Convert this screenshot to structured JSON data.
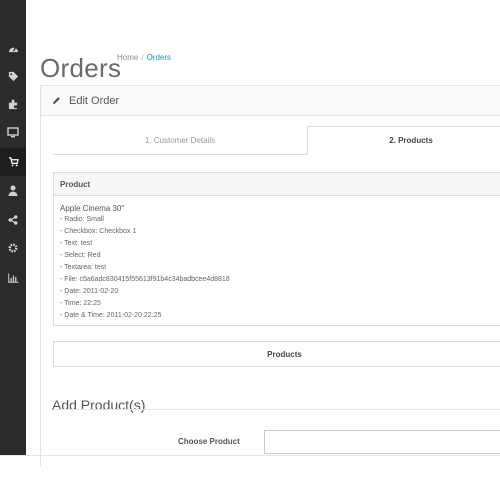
{
  "sidebar": {
    "items": [
      {
        "icon": "dashboard-icon",
        "active": false
      },
      {
        "icon": "tags-icon",
        "active": false
      },
      {
        "icon": "puzzle-icon",
        "active": false
      },
      {
        "icon": "desktop-icon",
        "active": false
      },
      {
        "icon": "shopping-cart-icon",
        "active": true
      },
      {
        "icon": "user-icon",
        "active": false
      },
      {
        "icon": "share-icon",
        "active": false
      },
      {
        "icon": "cog-icon",
        "active": false
      },
      {
        "icon": "bar-chart-icon",
        "active": false
      }
    ]
  },
  "page": {
    "title": "Orders",
    "breadcrumb": [
      "Home",
      "Orders"
    ]
  },
  "panel": {
    "title": "Edit Order",
    "icon": "pencil-icon"
  },
  "tabs": [
    {
      "label": "1. Customer Details",
      "active": false
    },
    {
      "label": "2. Products",
      "active": true
    }
  ],
  "product_table": {
    "header": "Product",
    "product_name": "Apple Cinema 30\"",
    "options": [
      "- Radio: Small",
      "- Checkbox: Checkbox 1",
      "- Text: test",
      "- Select: Red",
      "- Textarea: test",
      "- File: c5a6adc830415f55613f91b4c34badbcee4d8818",
      "- Date: 2011-02-20",
      "- Time: 22:25",
      "- Date & Time: 2011-02-20 22:25"
    ]
  },
  "products_button": "Products",
  "add_section": {
    "title": "Add Product(s)",
    "choose_label": "Choose Product",
    "choose_value": ""
  },
  "colors": {
    "sidebar_bg": "#2b2b2b",
    "link": "#1e91cf",
    "sidebar_icon": "#d0d0d0"
  }
}
